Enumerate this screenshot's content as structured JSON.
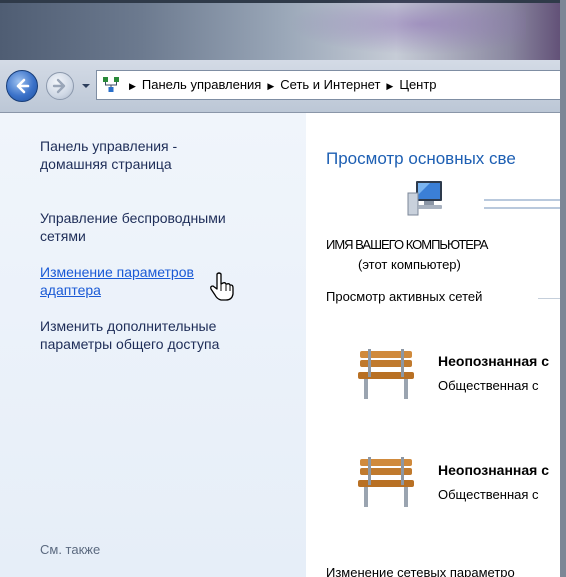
{
  "address": {
    "crumbs": [
      "Панель управления",
      "Сеть и Интернет",
      "Центр"
    ]
  },
  "sidebar": {
    "items": [
      {
        "label": "Панель управления -\nдомашняя страница"
      },
      {
        "label": "Управление беспроводными\nсетями"
      },
      {
        "label": "Изменение параметров\nадаптера"
      },
      {
        "label": "Изменить дополнительные\nпараметры общего доступа"
      }
    ],
    "see_also": "См. также"
  },
  "main": {
    "title": "Просмотр основных све",
    "computer_name": "ИМЯ ВАШЕГО КОМПЬЮТЕРА",
    "computer_sub": "(этот компьютер)",
    "active_networks_label": "Просмотр активных сетей",
    "networks": [
      {
        "name": "Неопознанная с",
        "type": "Общественная с"
      },
      {
        "name": "Неопознанная с",
        "type": "Общественная с"
      }
    ],
    "footer": "Изменение сетевых параметро"
  },
  "icons": [
    "back-arrow-icon",
    "forward-arrow-icon",
    "history-dropdown-icon",
    "network-control-panel-icon",
    "computer-monitor-icon",
    "park-bench-icon",
    "hand-cursor-icon"
  ],
  "colors": {
    "link": "#1a5ad6",
    "title": "#1d5fb3",
    "sidebar_bg": "#eaf1f9"
  }
}
